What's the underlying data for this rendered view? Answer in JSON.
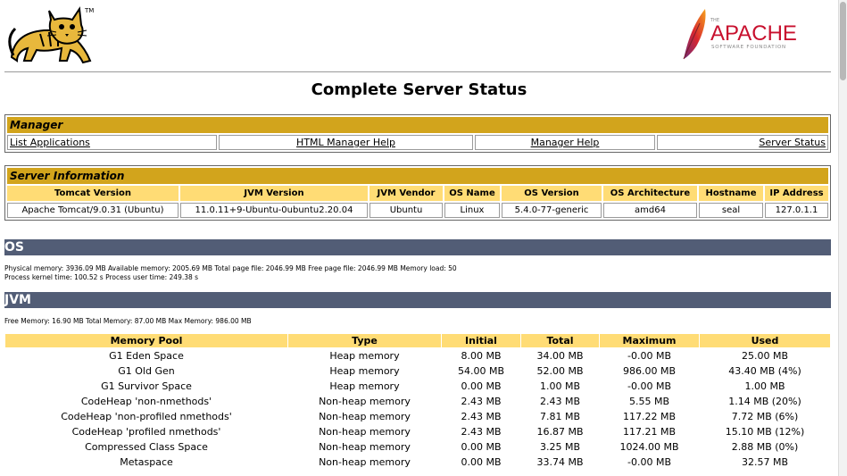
{
  "page": {
    "title": "Complete Server Status"
  },
  "logos": {
    "tomcat_tm": "TM",
    "apache_small": "THE",
    "apache_name": "APACHE",
    "apache_sub": "SOFTWARE FOUNDATION"
  },
  "manager": {
    "title": "Manager",
    "links": [
      "List Applications",
      "HTML Manager Help",
      "Manager Help",
      "Server Status"
    ]
  },
  "server_info": {
    "title": "Server Information",
    "headers": [
      "Tomcat Version",
      "JVM Version",
      "JVM Vendor",
      "OS Name",
      "OS Version",
      "OS Architecture",
      "Hostname",
      "IP Address"
    ],
    "values": [
      "Apache Tomcat/9.0.31 (Ubuntu)",
      "11.0.11+9-Ubuntu-0ubuntu2.20.04",
      "Ubuntu",
      "Linux",
      "5.4.0-77-generic",
      "amd64",
      "seal",
      "127.0.1.1"
    ]
  },
  "os": {
    "heading": "OS",
    "line1": "Physical memory: 3936.09 MB Available memory: 2005.69 MB Total page file: 2046.99 MB Free page file: 2046.99 MB Memory load: 50",
    "line2": "Process kernel time: 100.52 s Process user time: 249.38 s"
  },
  "jvm": {
    "heading": "JVM",
    "memory_line": "Free Memory: 16.90 MB Total Memory: 87.00 MB Max Memory: 986.00 MB",
    "headers": [
      "Memory Pool",
      "Type",
      "Initial",
      "Total",
      "Maximum",
      "Used"
    ],
    "pools": [
      [
        "G1 Eden Space",
        "Heap memory",
        "8.00 MB",
        "34.00 MB",
        "-0.00 MB",
        "25.00 MB"
      ],
      [
        "G1 Old Gen",
        "Heap memory",
        "54.00 MB",
        "52.00 MB",
        "986.00 MB",
        "43.40 MB (4%)"
      ],
      [
        "G1 Survivor Space",
        "Heap memory",
        "0.00 MB",
        "1.00 MB",
        "-0.00 MB",
        "1.00 MB"
      ],
      [
        "CodeHeap 'non-nmethods'",
        "Non-heap memory",
        "2.43 MB",
        "2.43 MB",
        "5.55 MB",
        "1.14 MB (20%)"
      ],
      [
        "CodeHeap 'non-profiled nmethods'",
        "Non-heap memory",
        "2.43 MB",
        "7.81 MB",
        "117.22 MB",
        "7.72 MB (6%)"
      ],
      [
        "CodeHeap 'profiled nmethods'",
        "Non-heap memory",
        "2.43 MB",
        "16.87 MB",
        "117.21 MB",
        "15.10 MB (12%)"
      ],
      [
        "Compressed Class Space",
        "Non-heap memory",
        "0.00 MB",
        "3.25 MB",
        "1024.00 MB",
        "2.88 MB (0%)"
      ],
      [
        "Metaspace",
        "Non-heap memory",
        "0.00 MB",
        "33.74 MB",
        "-0.00 MB",
        "32.57 MB"
      ]
    ]
  },
  "colors": {
    "gold": "#d2a41c",
    "header_yellow": "#ffdc75",
    "section_blue": "#525d76",
    "apache_red": "#c8102e"
  }
}
